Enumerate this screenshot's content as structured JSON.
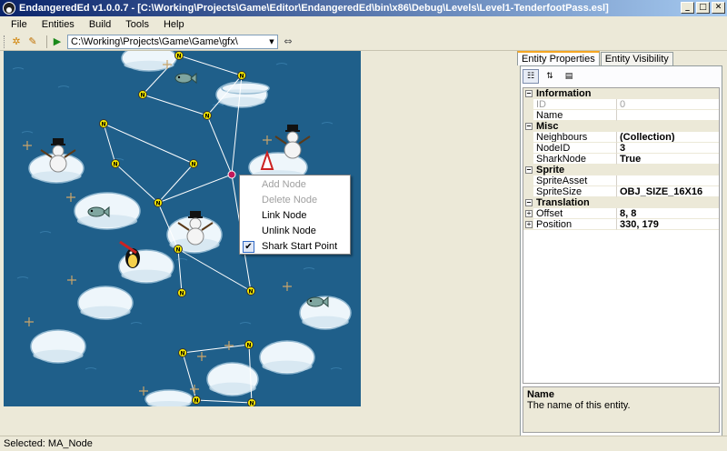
{
  "window": {
    "title": "EndangeredEd v1.0.0.7 - [C:\\Working\\Projects\\Game\\Editor\\EndangeredEd\\bin\\x86\\Debug\\Levels\\Level1-TenderfootPass.esl]",
    "minimize_glyph": "_",
    "maximize_glyph": "□",
    "close_glyph": "✕"
  },
  "menu": [
    "File",
    "Entities",
    "Build",
    "Tools",
    "Help"
  ],
  "toolbar": {
    "path": "C:\\Working\\Projects\\Game\\Game\\gfx\\"
  },
  "canvas": {
    "node_label": "N",
    "colors": {
      "water": "#1f5f8a",
      "ice": "#eef6fb",
      "link": "#ffffff",
      "node": "#f2e600"
    }
  },
  "context_menu": {
    "items": [
      {
        "label": "Add Node",
        "enabled": false,
        "checked": false
      },
      {
        "label": "Delete Node",
        "enabled": false,
        "checked": false
      },
      {
        "label": "Link Node",
        "enabled": true,
        "checked": false
      },
      {
        "label": "Unlink Node",
        "enabled": true,
        "checked": false
      },
      {
        "label": "Shark Start Point",
        "enabled": true,
        "checked": true
      }
    ],
    "check_glyph": "✔"
  },
  "properties": {
    "tabs": [
      "Entity Properties",
      "Entity Visibility"
    ],
    "categories": [
      {
        "name": "Information",
        "rows": [
          {
            "name": "ID",
            "value": "0",
            "readonly": true,
            "bold": false
          },
          {
            "name": "Name",
            "value": "",
            "readonly": false,
            "bold": false
          }
        ]
      },
      {
        "name": "Misc",
        "rows": [
          {
            "name": "Neighbours",
            "value": "(Collection)",
            "readonly": false,
            "bold": true
          },
          {
            "name": "NodeID",
            "value": "3",
            "readonly": false,
            "bold": true
          },
          {
            "name": "SharkNode",
            "value": "True",
            "readonly": false,
            "bold": true
          }
        ]
      },
      {
        "name": "Sprite",
        "rows": [
          {
            "name": "SpriteAsset",
            "value": "",
            "readonly": false,
            "bold": false
          },
          {
            "name": "SpriteSize",
            "value": "OBJ_SIZE_16X16",
            "readonly": false,
            "bold": true
          }
        ]
      },
      {
        "name": "Translation",
        "rows": [
          {
            "name": "Offset",
            "value": "8, 8",
            "readonly": false,
            "bold": true,
            "expandable": true
          },
          {
            "name": "Position",
            "value": "330, 179",
            "readonly": false,
            "bold": true,
            "expandable": true
          }
        ]
      }
    ],
    "description": {
      "title": "Name",
      "text": "The name of this entity."
    }
  },
  "status": "Selected: MA_Node"
}
